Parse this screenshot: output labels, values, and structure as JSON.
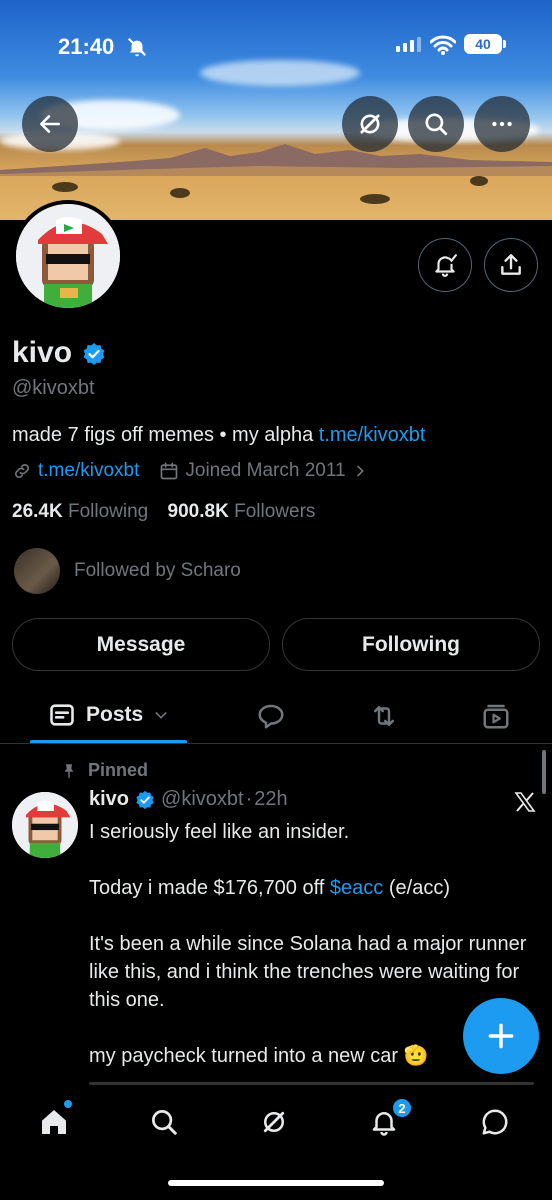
{
  "status_bar": {
    "time": "21:40",
    "battery": "40"
  },
  "profile": {
    "name": "kivo",
    "handle": "@kivoxbt",
    "bio_text": "made 7 figs off memes • my alpha ",
    "bio_link": "t.me/kivoxbt",
    "website": "t.me/kivoxbt",
    "joined": "Joined March 2011",
    "following_count": "26.4K",
    "following_label": "Following",
    "followers_count": "900.8K",
    "followers_label": "Followers",
    "followed_by": "Followed by Scharo"
  },
  "actions": {
    "message_label": "Message",
    "following_label": "Following"
  },
  "tabs": {
    "posts_label": "Posts"
  },
  "post": {
    "pinned_label": "Pinned",
    "author_name": "kivo",
    "author_handle": "@kivoxbt",
    "separator": "·",
    "time_ago": "22h",
    "line1": "I seriously feel like an insider.",
    "line2_pre": "Today i made $176,700 off ",
    "cashtag": "$eacc",
    "line2_post": " (e/acc)",
    "line3": "It's been a while since Solana had a major runner like this, and i think the trenches were waiting for this one.",
    "line4": "my paycheck turned into a new car 🫡"
  },
  "nav": {
    "notification_badge": "2"
  },
  "colors": {
    "accent": "#1d9bf0",
    "background": "#000000",
    "muted": "#71767b"
  }
}
